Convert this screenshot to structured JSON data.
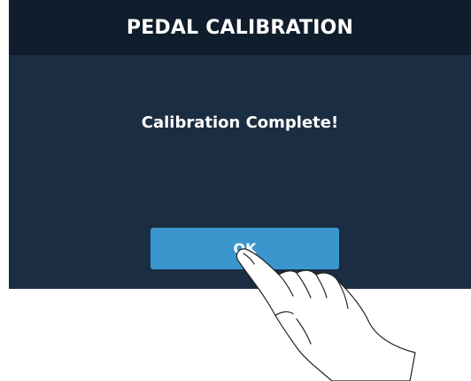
{
  "dialog": {
    "title": "PEDAL CALIBRATION",
    "message": "Calibration Complete!",
    "ok_label": "OK"
  },
  "colors": {
    "screen_background": "#1b2d42",
    "title_bar": "#101d2c",
    "button": "#3a96cc",
    "text": "#ffffff"
  },
  "icons": {
    "pointer": "tapping-hand-icon"
  }
}
